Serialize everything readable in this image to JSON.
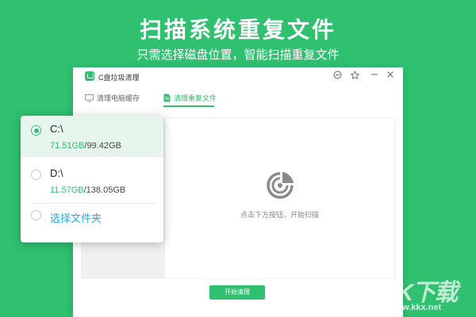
{
  "banner": {
    "title": "扫描系统重复文件",
    "subtitle": "只需选择磁盘位置，智能扫描重复文件"
  },
  "window": {
    "title": "C盘垃圾清理",
    "tabs": [
      {
        "label": "清理电脑缓存",
        "icon": "monitor-icon",
        "active": false
      },
      {
        "label": "清理重复文件",
        "icon": "file-icon",
        "active": true
      }
    ],
    "empty_state": "点击下方按钮，开始扫描",
    "start_button": "开始清理"
  },
  "dropdown": {
    "drives": [
      {
        "name": "C:\\",
        "used": "71.51GB",
        "sep": "/",
        "total": "99.42GB",
        "selected": true
      },
      {
        "name": "D:\\",
        "used": "11.57GB",
        "sep": "/",
        "total": "138.05GB",
        "selected": false
      }
    ],
    "choose_folder": "选择文件夹"
  },
  "watermark": {
    "text": "KK下载",
    "url": "www.kkx.net"
  },
  "colors": {
    "brand": "#2fc070",
    "link": "#2fa8e6"
  }
}
